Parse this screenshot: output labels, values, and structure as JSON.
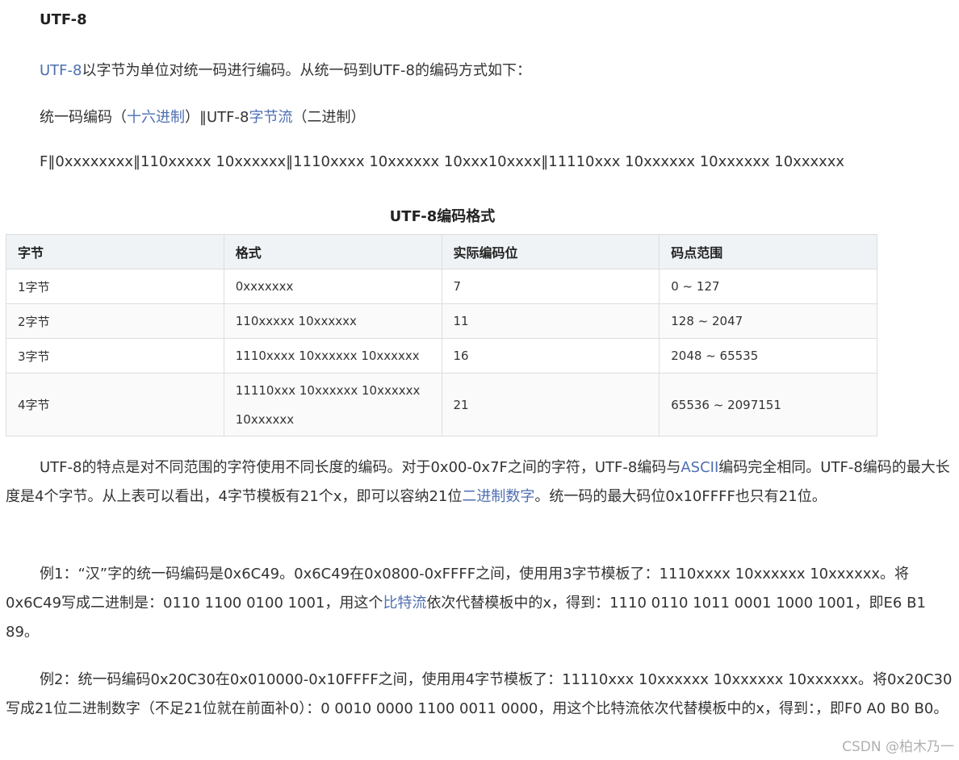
{
  "heading": "UTF-8",
  "intro": {
    "link": "UTF-8",
    "text": "以字节为单位对统一码进行编码。从统一码到UTF-8的编码方式如下："
  },
  "mapping_header": {
    "part1": "统一码编码（",
    "link1": "十六进制",
    "part2": "）‖UTF-8",
    "link2": "字节流",
    "part3": "（二进制）"
  },
  "format_line": "F‖0xxxxxxxx‖110xxxxx 10xxxxxx‖1110xxxx 10xxxxxx 10xxx10xxxx‖11110xxx 10xxxxxx 10xxxxxx 10xxxxxx",
  "table": {
    "caption": "UTF-8编码格式",
    "headers": [
      "字节",
      "格式",
      "实际编码位",
      "码点范围"
    ],
    "rows": [
      [
        "1字节",
        "0xxxxxxx",
        "7",
        "0 ~ 127"
      ],
      [
        "2字节",
        "110xxxxx 10xxxxxx",
        "11",
        "128 ~ 2047"
      ],
      [
        "3字节",
        "1110xxxx 10xxxxxx 10xxxxxx",
        "16",
        "2048 ~ 65535"
      ],
      [
        "4字节",
        "11110xxx 10xxxxxx 10xxxxxx 10xxxxxx",
        "21",
        "65536 ~ 2097151"
      ]
    ]
  },
  "para1": {
    "t1": "UTF-8的特点是对不同范围的字符使用不同长度的编码。对于0x00-0x7F之间的字符，UTF-8编码与",
    "link1": "ASCII",
    "t2": "编码完全相同。UTF-8编码的最大长度是4个字节。从上表可以看出，4字节模板有21个x，即可以容纳21位",
    "link2": "二进制数字",
    "t3": "。统一码的最大码位0x10FFFF也只有21位。"
  },
  "para2": {
    "t1": "例1：“汉”字的统一码编码是0x6C49。0x6C49在0x0800-0xFFFF之间，使用用3字节模板了：1110xxxx 10xxxxxx 10xxxxxx。将0x6C49写成二进制是：0110 1100 0100 1001，用这个",
    "link": "比特流",
    "t2": "依次代替模板中的x，得到：1110 0110 1011 0001 1000 1001，即E6 B1 89。"
  },
  "para3": {
    "text": "例2：统一码编码0x20C30在0x010000-0x10FFFF之间，使用用4字节模板了：11110xxx 10xxxxxx 10xxxxxx 10xxxxxx。将0x20C30写成21位二进制数字（不足21位就在前面补0）：0 0010 0000 1100 0011 0000，用这个比特流依次代替模板中的x，得到：，即F0 A0 B0 B0。"
  },
  "watermark": "CSDN @柏木乃一"
}
